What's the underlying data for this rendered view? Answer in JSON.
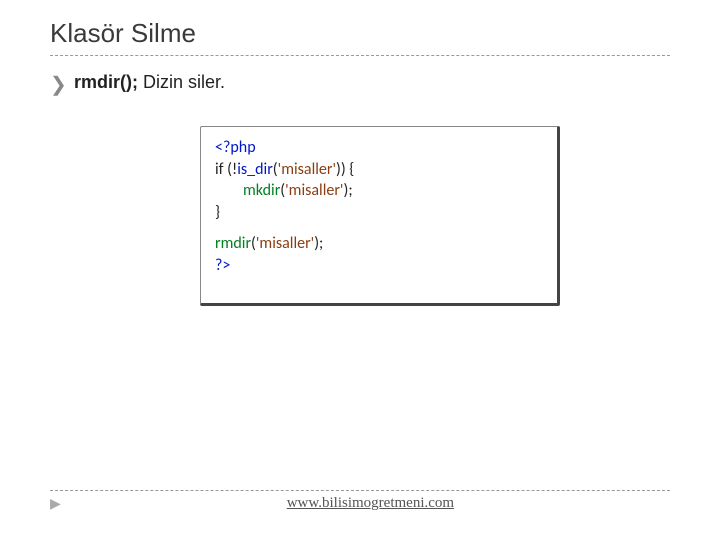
{
  "title": "Klasör Silme",
  "desc": {
    "bold": "rmdir();",
    "rest": " Dizin siler."
  },
  "code": {
    "l1_open": "<?php",
    "l2_a": "if (!",
    "l2_b": "is_dir",
    "l2_c": "(",
    "l2_d": "'misaller'",
    "l2_e": ")) {",
    "l3_a": "mkdir",
    "l3_b": "(",
    "l3_c": "'misaller'",
    "l3_d": ");",
    "l4": "}",
    "l5_a": "rmdir",
    "l5_b": "(",
    "l5_c": "'misaller'",
    "l5_d": ");",
    "l6_close": "?>"
  },
  "footer": {
    "url": "www.bilisimogretmeni.com"
  },
  "icons": {
    "bullet": "❯",
    "footer_play": "▶"
  }
}
